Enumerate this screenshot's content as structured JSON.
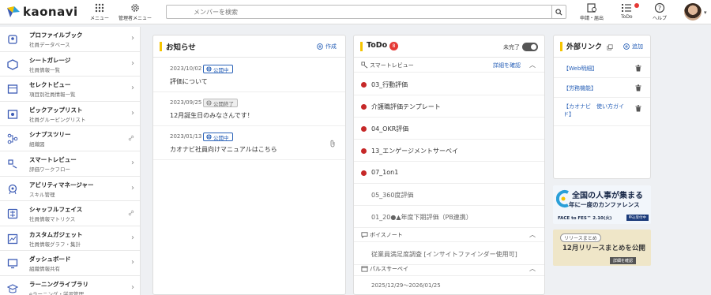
{
  "header": {
    "logo": "kaonavi",
    "menu_label": "メニュー",
    "admin_menu_label": "管理者メニュー",
    "search_placeholder": "メンバーを検索",
    "apply_label": "申請・届出",
    "todo_label": "ToDo",
    "help_label": "ヘルプ"
  },
  "sidebar": {
    "items": [
      {
        "title": "プロファイルブック",
        "sub": "社員データベース",
        "icon": "profile-book-icon",
        "trail": "arrow"
      },
      {
        "title": "シートガレージ",
        "sub": "社員情報一覧",
        "icon": "sheet-garage-icon",
        "trail": "arrow"
      },
      {
        "title": "セレクトビュー",
        "sub": "項目別社員情報一覧",
        "icon": "select-view-icon",
        "trail": "arrow"
      },
      {
        "title": "ピックアップリスト",
        "sub": "社員グルーピングリスト",
        "icon": "pickup-list-icon",
        "trail": "arrow"
      },
      {
        "title": "シナプスツリー",
        "sub": "組織図",
        "icon": "synapse-tree-icon",
        "trail": "link"
      },
      {
        "title": "スマートレビュー",
        "sub": "評価ワークフロー",
        "icon": "smart-review-icon",
        "trail": "arrow"
      },
      {
        "title": "アビリティマネージャー",
        "sub": "スキル管理",
        "icon": "ability-manager-icon",
        "trail": "arrow"
      },
      {
        "title": "シャッフルフェイス",
        "sub": "社員情報マトリクス",
        "icon": "shuffle-face-icon",
        "trail": "link"
      },
      {
        "title": "カスタムガジェット",
        "sub": "社員情報グラフ・集計",
        "icon": "custom-gadget-icon",
        "trail": "arrow"
      },
      {
        "title": "ダッシュボード",
        "sub": "組織情報共有",
        "icon": "dashboard-icon",
        "trail": "arrow"
      },
      {
        "title": "ラーニングライブラリ",
        "sub": "eラーニング・学習管理",
        "icon": "learning-library-icon",
        "trail": "arrow"
      }
    ]
  },
  "notices": {
    "title": "お知らせ",
    "create_label": "作成",
    "items": [
      {
        "date": "2023/10/02",
        "status": "公開中",
        "status_type": "open",
        "title": "評価について",
        "attachment": false
      },
      {
        "date": "2023/09/25",
        "status": "公開終了",
        "status_type": "ended",
        "title": "12月誕生日のみなさんです！",
        "attachment": false
      },
      {
        "date": "2023/01/13",
        "status": "公開中",
        "status_type": "open",
        "title": "カオナビ社員向けマニュアルはこちら",
        "attachment": true
      }
    ]
  },
  "todo": {
    "title": "ToDo",
    "count": "8",
    "incomplete_label": "未完了",
    "smart_review": {
      "label": "スマートレビュー",
      "detail_link": "詳細を確認",
      "items": [
        {
          "text": "03_行動評価",
          "pending": true
        },
        {
          "text": "介護職評価テンプレート",
          "pending": true
        },
        {
          "text": "04_OKR評価",
          "pending": true
        },
        {
          "text": "13_エンゲージメントサーベイ",
          "pending": true
        },
        {
          "text": "07_1on1",
          "pending": true
        },
        {
          "text": "05_360度評価",
          "pending": false
        },
        {
          "text": "01_20●▲年度下期評価（PB連携）",
          "pending": false
        }
      ]
    },
    "voice_note": {
      "label": "ボイスノート",
      "items": [
        {
          "text": "従業員満足度調査 [インサイトファインダー使用可]"
        }
      ]
    },
    "pulse_survey": {
      "label": "パルスサーベイ",
      "items": [
        {
          "text": "2025/12/29～2026/01/25"
        }
      ]
    }
  },
  "external_links": {
    "title": "外部リンク",
    "add_label": "追加",
    "items": [
      {
        "text": "【Web明細】"
      },
      {
        "text": "【労務機能】"
      },
      {
        "text": "【カオナビ　使い方ガイド】"
      }
    ]
  },
  "banners": [
    {
      "line1": "全国の人事が集まる",
      "line2": "年に一度のカンファレンス",
      "line3": "FACE to FES™ 2.10(火)",
      "cta": "申込受付中"
    },
    {
      "tag": "リリースまとめ",
      "headline": "12月リリースまとめを公開",
      "cta": "詳細を確認"
    }
  ],
  "colors": {
    "accent_blue": "#2a62b8",
    "todo_red": "#c62828",
    "title_bar": "#f5c400"
  }
}
